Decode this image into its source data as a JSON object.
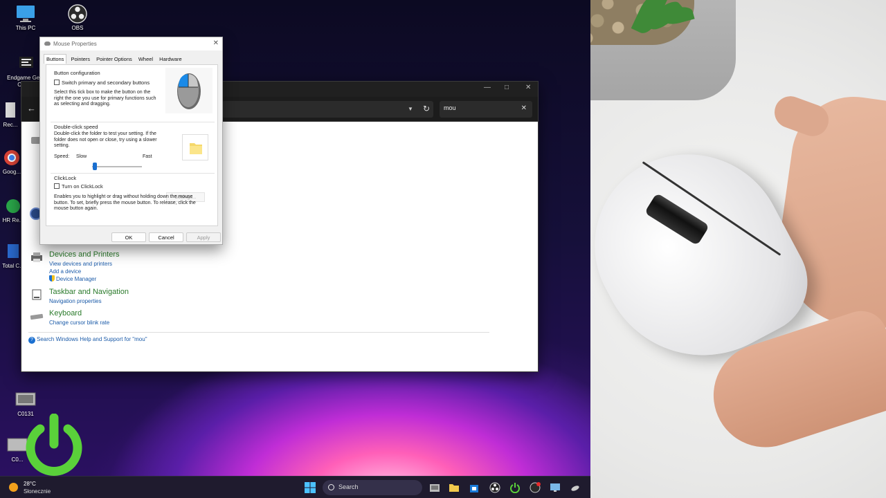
{
  "desktop": {
    "icons": [
      {
        "label": "This PC"
      },
      {
        "label": "OBS"
      },
      {
        "label": "Endgame Ge... Conf..."
      },
      {
        "label": "Rec..."
      },
      {
        "label": "Goog..."
      },
      {
        "label": "HR Re..."
      },
      {
        "label": "Total C..."
      },
      {
        "label": "C0131"
      },
      {
        "label": "C0..."
      }
    ]
  },
  "control_panel": {
    "search_value": "mou",
    "groups": [
      {
        "title": "Devices and Printers",
        "links": [
          "View devices and printers",
          "Add a device",
          "Device Manager"
        ]
      },
      {
        "title": "Taskbar and Navigation",
        "links": [
          "Navigation properties"
        ]
      },
      {
        "title": "Keyboard",
        "links": [
          "Change cursor blink rate"
        ]
      }
    ],
    "help_link": "Search Windows Help and Support for \"mou\""
  },
  "mouse_properties": {
    "title": "Mouse Properties",
    "tabs": [
      "Buttons",
      "Pointers",
      "Pointer Options",
      "Wheel",
      "Hardware"
    ],
    "active_tab": "Buttons",
    "button_config": {
      "title": "Button configuration",
      "checkbox_label": "Switch primary and secondary buttons",
      "checked": false,
      "description": "Select this tick box to make the button on the right the one you use for primary functions such as selecting and dragging."
    },
    "double_click": {
      "title": "Double-click speed",
      "description": "Double-click the folder to test your setting. If the folder does not open or close, try using a slower setting.",
      "speed_label": "Speed:",
      "slow_label": "Slow",
      "fast_label": "Fast",
      "speed_value": 0.05
    },
    "clicklock": {
      "title": "ClickLock",
      "checkbox_label": "Turn on ClickLock",
      "checked": false,
      "settings_button": "Settings...",
      "description": "Enables you to highlight or drag without holding down the mouse button. To set, briefly press the mouse button. To release, click the mouse button again."
    },
    "buttons": {
      "ok": "OK",
      "cancel": "Cancel",
      "apply": "Apply"
    }
  },
  "taskbar": {
    "weather_temp": "28°C",
    "weather_desc": "Słonecznie",
    "search_placeholder": "Search"
  },
  "colors": {
    "accent": "#1a6fd0",
    "cp_heading": "#2a7a2a",
    "cp_link": "#1a5aa8",
    "power_icon": "#5ad13a"
  }
}
